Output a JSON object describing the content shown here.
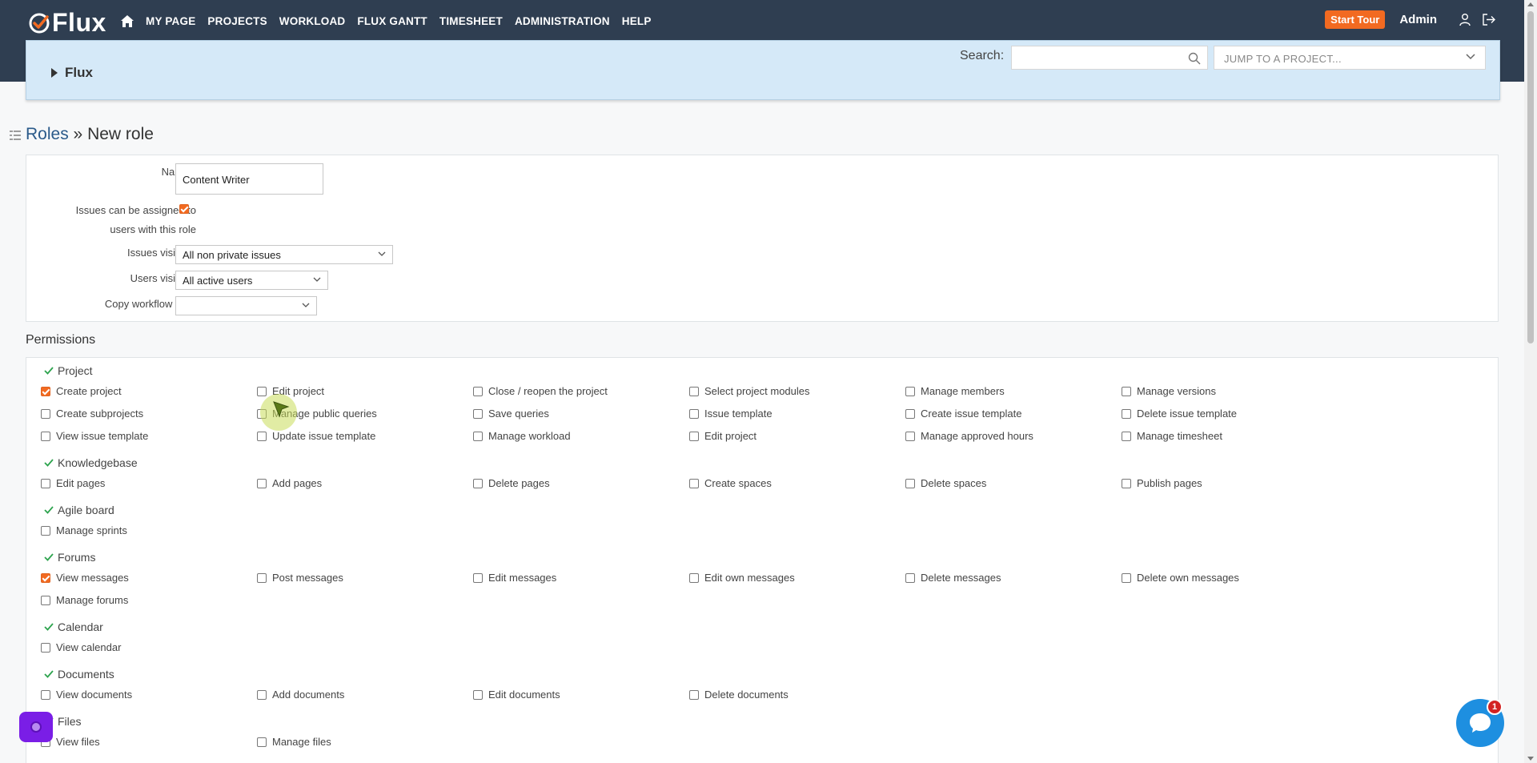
{
  "header": {
    "logo_text": "Flux",
    "nav": [
      "MY PAGE",
      "PROJECTS",
      "WORKLOAD",
      "FLUX GANTT",
      "TIMESHEET",
      "ADMINISTRATION",
      "HELP"
    ],
    "start_tour": "Start Tour",
    "user": "Admin"
  },
  "project_bar": {
    "project_name": "Flux",
    "search_label": "Search:",
    "search_value": "",
    "jump_placeholder": "JUMP TO A PROJECT..."
  },
  "breadcrumb": {
    "parent": "Roles",
    "separator": "»",
    "current": "New role"
  },
  "form": {
    "name_label": "Name",
    "required_mark": "*",
    "name_value": "Content Writer",
    "assignable_label_1": "Issues can be assigned to",
    "assignable_label_2": "users with this role",
    "assignable_checked": true,
    "issues_visibility_label": "Issues visibility",
    "issues_visibility_value": "All non private issues",
    "users_visibility_label": "Users visibility",
    "users_visibility_value": "All active users",
    "copy_workflow_label": "Copy workflow from",
    "copy_workflow_value": ""
  },
  "permissions": {
    "title": "Permissions",
    "groups": [
      {
        "name": "Project",
        "items": [
          {
            "label": "Create project",
            "checked": true
          },
          {
            "label": "Edit project",
            "checked": false
          },
          {
            "label": "Close / reopen the project",
            "checked": false
          },
          {
            "label": "Select project modules",
            "checked": false
          },
          {
            "label": "Manage members",
            "checked": false
          },
          {
            "label": "Manage versions",
            "checked": false
          },
          {
            "label": "Create subprojects",
            "checked": false
          },
          {
            "label": "Manage public queries",
            "checked": false
          },
          {
            "label": "Save queries",
            "checked": false
          },
          {
            "label": "Issue template",
            "checked": false
          },
          {
            "label": "Create issue template",
            "checked": false
          },
          {
            "label": "Delete issue template",
            "checked": false
          },
          {
            "label": "View issue template",
            "checked": false
          },
          {
            "label": "Update issue template",
            "checked": false
          },
          {
            "label": "Manage workload",
            "checked": false
          },
          {
            "label": "Edit project",
            "checked": false
          },
          {
            "label": "Manage approved hours",
            "checked": false
          },
          {
            "label": "Manage timesheet",
            "checked": false
          }
        ]
      },
      {
        "name": "Knowledgebase",
        "items": [
          {
            "label": "Edit pages",
            "checked": false
          },
          {
            "label": "Add pages",
            "checked": false
          },
          {
            "label": "Delete pages",
            "checked": false
          },
          {
            "label": "Create spaces",
            "checked": false
          },
          {
            "label": "Delete spaces",
            "checked": false
          },
          {
            "label": "Publish pages",
            "checked": false
          }
        ]
      },
      {
        "name": "Agile board",
        "items": [
          {
            "label": "Manage sprints",
            "checked": false
          }
        ]
      },
      {
        "name": "Forums",
        "items": [
          {
            "label": "View messages",
            "checked": true
          },
          {
            "label": "Post messages",
            "checked": false
          },
          {
            "label": "Edit messages",
            "checked": false
          },
          {
            "label": "Edit own messages",
            "checked": false
          },
          {
            "label": "Delete messages",
            "checked": false
          },
          {
            "label": "Delete own messages",
            "checked": false
          },
          {
            "label": "Manage forums",
            "checked": false
          }
        ]
      },
      {
        "name": "Calendar",
        "items": [
          {
            "label": "View calendar",
            "checked": false
          }
        ]
      },
      {
        "name": "Documents",
        "items": [
          {
            "label": "View documents",
            "checked": false
          },
          {
            "label": "Add documents",
            "checked": false
          },
          {
            "label": "Edit documents",
            "checked": false
          },
          {
            "label": "Delete documents",
            "checked": false
          }
        ]
      },
      {
        "name": "Files",
        "items": [
          {
            "label": "View files",
            "checked": false
          },
          {
            "label": "Manage files",
            "checked": false
          }
        ]
      }
    ]
  },
  "chat": {
    "badge": "1"
  },
  "colors": {
    "accent": "#f26a21",
    "header_bg": "#2f3e51",
    "group_check": "#2ea44f",
    "chat": "#1e8fe0"
  }
}
